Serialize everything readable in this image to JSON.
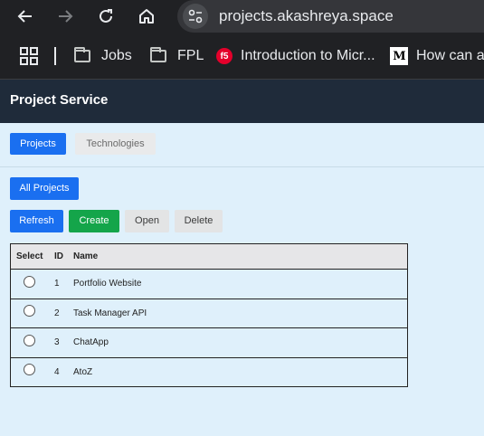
{
  "browser": {
    "url": "projects.akashreya.space",
    "icons": {
      "back": "arrow-left-icon",
      "forward": "arrow-right-icon",
      "reload": "reload-icon",
      "home": "home-icon",
      "site_info": "tune-icon"
    },
    "bookmarks": [
      {
        "label": "Jobs",
        "icon": "folder-icon"
      },
      {
        "label": "FPL",
        "icon": "folder-icon"
      },
      {
        "label": "Introduction to Micr...",
        "icon": "f5-favicon"
      },
      {
        "label": "How can an",
        "icon": "medium-favicon"
      }
    ]
  },
  "app": {
    "title": "Project Service",
    "tabs": [
      {
        "label": "Projects",
        "active": true
      },
      {
        "label": "Technologies",
        "active": false
      }
    ],
    "all_projects_label": "All Projects",
    "actions": {
      "refresh": "Refresh",
      "create": "Create",
      "open": "Open",
      "delete": "Delete"
    },
    "table": {
      "columns": [
        "Select",
        "ID",
        "Name"
      ],
      "rows": [
        {
          "id": "1",
          "name": "Portfolio Website"
        },
        {
          "id": "2",
          "name": "Task Manager API"
        },
        {
          "id": "3",
          "name": "ChatApp"
        },
        {
          "id": "4",
          "name": "AtoZ"
        }
      ]
    }
  },
  "colors": {
    "page_bg": "#dff0fb",
    "header_bg": "#1f2b3a",
    "primary": "#1a6ff0",
    "success": "#14a54a"
  }
}
